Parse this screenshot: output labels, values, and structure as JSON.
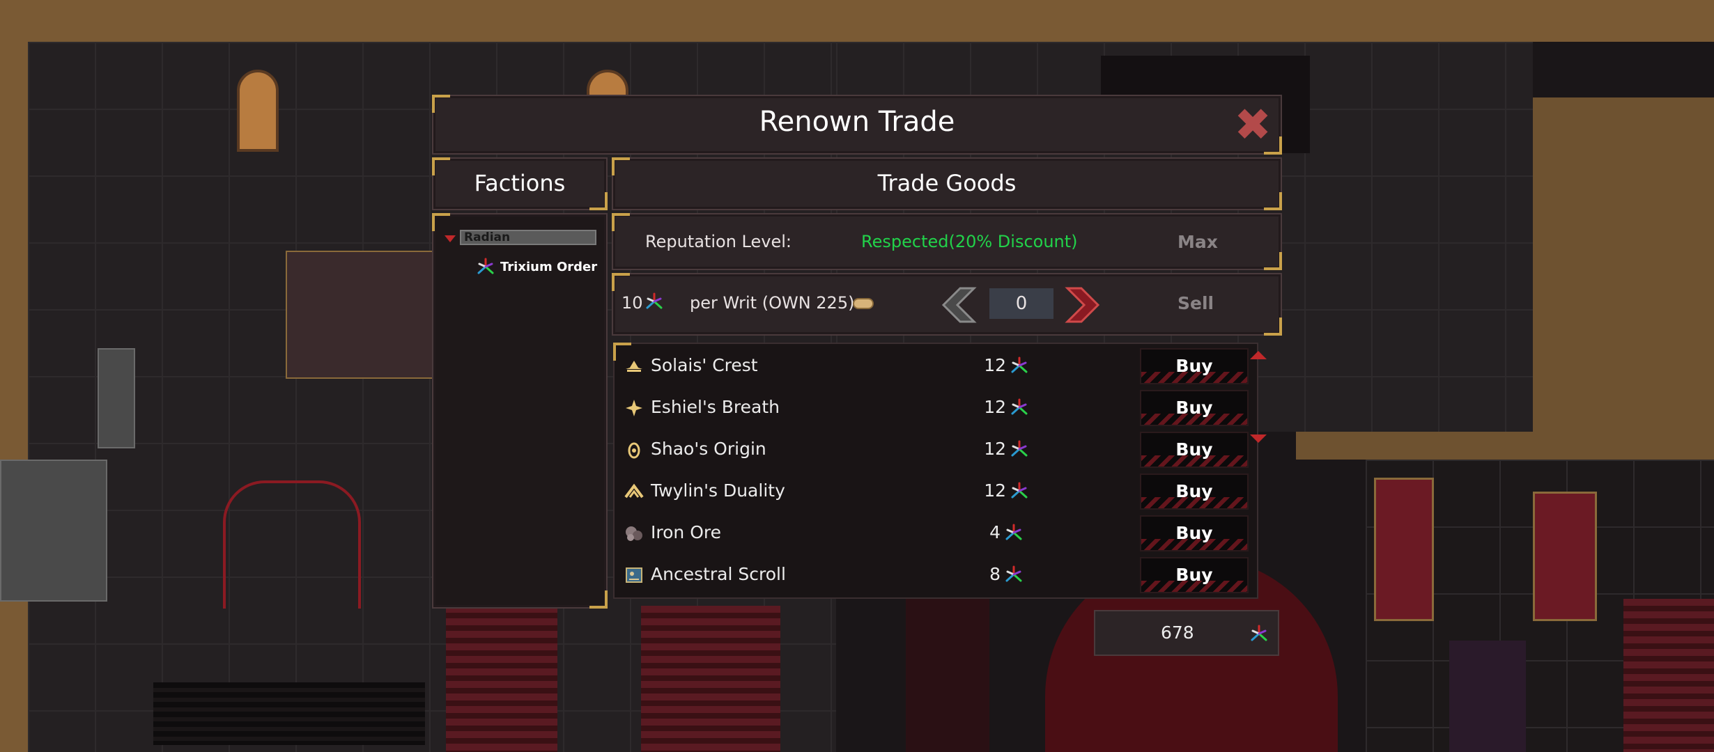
{
  "dialog": {
    "title": "Renown Trade",
    "close_icon": "close-x-icon"
  },
  "factions": {
    "header": "Factions",
    "group": "Radian",
    "items": [
      {
        "label": "Trixium Order",
        "icon": "trixium-star-icon"
      }
    ]
  },
  "trade": {
    "header": "Trade Goods",
    "reputation_label": "Reputation Level:",
    "reputation_value": "Respected(20% Discount)",
    "max_label": "Max",
    "writ_count": "10",
    "writ_text": "per Writ (OWN 225)",
    "quantity": "0",
    "sell_label": "Sell",
    "goods": [
      {
        "name": "Solais' Crest",
        "price": "12",
        "icon": "crest-icon",
        "buy": "Buy"
      },
      {
        "name": "Eshiel's Breath",
        "price": "12",
        "icon": "breath-star-icon",
        "buy": "Buy"
      },
      {
        "name": "Shao's Origin",
        "price": "12",
        "icon": "origin-mask-icon",
        "buy": "Buy"
      },
      {
        "name": "Twylin's Duality",
        "price": "12",
        "icon": "duality-icon",
        "buy": "Buy"
      },
      {
        "name": "Iron Ore",
        "price": "4",
        "icon": "iron-ore-icon",
        "buy": "Buy"
      },
      {
        "name": "Ancestral Scroll",
        "price": "8",
        "icon": "scroll-icon",
        "buy": "Buy"
      }
    ]
  },
  "balance": {
    "value": "678"
  },
  "colors": {
    "accent_gold": "#c9a14a",
    "discount_green": "#22d24a",
    "danger_red": "#c0282a",
    "panel": "#2c2426"
  }
}
